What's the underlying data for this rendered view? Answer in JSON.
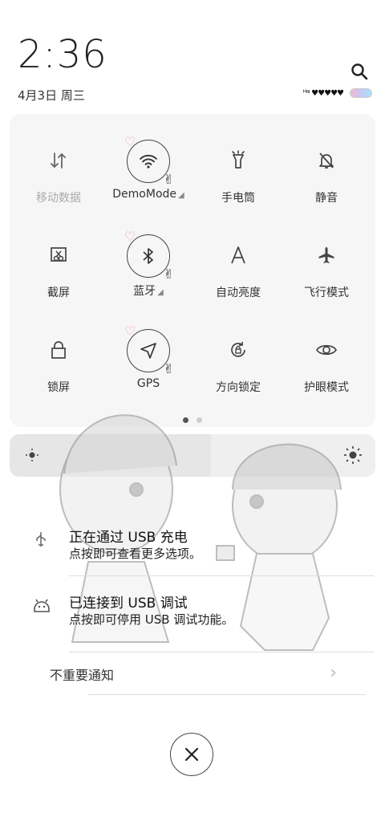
{
  "header": {
    "time": "2:36",
    "date": "4月3日 周三",
    "status_art": "ᴴᵃᶦ ♥♥♥♥♥"
  },
  "quick_settings": {
    "tiles": [
      {
        "label": "移动数据",
        "icon": "mobile-data-icon",
        "active": false
      },
      {
        "label": "DemoMode",
        "icon": "wifi-icon",
        "active": true
      },
      {
        "label": "手电筒",
        "icon": "flashlight-icon",
        "active": false
      },
      {
        "label": "静音",
        "icon": "mute-icon",
        "active": false
      },
      {
        "label": "截屏",
        "icon": "screenshot-icon",
        "active": false
      },
      {
        "label": "蓝牙",
        "icon": "bluetooth-icon",
        "active": true
      },
      {
        "label": "自动亮度",
        "icon": "auto-brightness-icon",
        "active": false
      },
      {
        "label": "飞行模式",
        "icon": "airplane-icon",
        "active": false
      },
      {
        "label": "锁屏",
        "icon": "lock-icon",
        "active": false
      },
      {
        "label": "GPS",
        "icon": "gps-icon",
        "active": true
      },
      {
        "label": "方向锁定",
        "icon": "rotation-lock-icon",
        "active": false
      },
      {
        "label": "护眼模式",
        "icon": "eye-icon",
        "active": false
      }
    ],
    "pages": 2,
    "current_page": 1
  },
  "brightness": {
    "level": 0.55
  },
  "notifications": [
    {
      "title": "正在通过 USB 充电",
      "subtitle": "点按即可查看更多选项。",
      "icon": "usb-icon"
    },
    {
      "title": "已连接到 USB 调试",
      "subtitle": "点按即可停用 USB 调试功能。",
      "icon": "android-debug-icon"
    }
  ],
  "unimportant": {
    "label": "不重要通知"
  },
  "colors": {
    "panel_bg": "#f6f6f6",
    "heart": "#f19bb2"
  }
}
